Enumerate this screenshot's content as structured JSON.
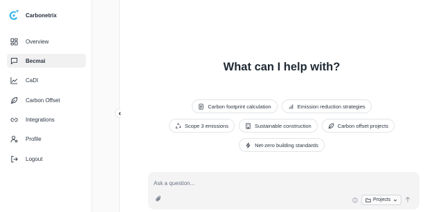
{
  "brand": {
    "name": "Carbonetrix",
    "accent": "#38b6e8"
  },
  "sidebar": {
    "items": [
      {
        "label": "Overview",
        "icon": "dashboard-icon",
        "active": false
      },
      {
        "label": "Becmai",
        "icon": "chat-icon",
        "active": true
      },
      {
        "label": "CaDI",
        "icon": "trend-chart-icon",
        "active": false
      },
      {
        "label": "Carbon Offset",
        "icon": "leaf-icon",
        "active": false
      },
      {
        "label": "Integrations",
        "icon": "link-icon",
        "active": false
      },
      {
        "label": "Profile",
        "icon": "user-settings-icon",
        "active": false
      },
      {
        "label": "Logout",
        "icon": "logout-icon",
        "active": false
      }
    ]
  },
  "main": {
    "headline": "What can I help with?",
    "suggestions": [
      {
        "label": "Carbon footprint calculation",
        "icon": "document-icon"
      },
      {
        "label": "Emission reduction strategies",
        "icon": "bar-chart-icon"
      },
      {
        "label": "Scope 3 emissions",
        "icon": "recycle-icon"
      },
      {
        "label": "Sustainable construction",
        "icon": "building-icon"
      },
      {
        "label": "Carbon offset projects",
        "icon": "leaf-icon"
      },
      {
        "label": "Net-zero building standards",
        "icon": "bolt-icon"
      }
    ]
  },
  "composer": {
    "placeholder": "Ask a question...",
    "value": "",
    "projects_label": "Projects"
  }
}
